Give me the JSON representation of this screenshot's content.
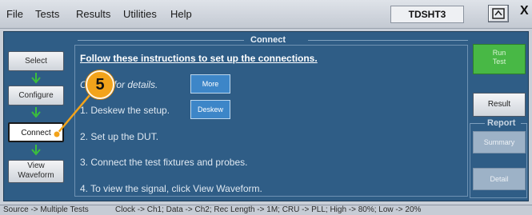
{
  "menu": {
    "items": [
      "File",
      "Tests",
      "Results",
      "Utilities",
      "Help"
    ],
    "instrument": "TDSHT3",
    "close_glyph": "X"
  },
  "panel": {
    "title": "Connect",
    "headline": "Follow these instructions to set up the connections.",
    "step0_prefix": "C",
    "step0_suffix": "for details.",
    "step1": "1. Deskew the setup.",
    "step2": "2. Set up the DUT.",
    "step3": "3. Connect the test fixtures and probes.",
    "step4": "4. To view the signal, click View Waveform.",
    "more_label": "More",
    "deskew_label": "Deskew"
  },
  "workflow": {
    "select": "Select",
    "configure": "Configure",
    "connect": "Connect",
    "view_line1": "View",
    "view_line2": "Waveform"
  },
  "callout": {
    "number": "5"
  },
  "right": {
    "run_line1": "Run",
    "run_line2": "Test",
    "result": "Result",
    "report": "Report",
    "summary": "Summary",
    "detail": "Detail"
  },
  "status": {
    "left": "Source -> Multiple Tests",
    "right": "Clock -> Ch1; Data -> Ch2; Rec Length -> 1M; CRU -> PLL; High -> 80%; Low -> 20%"
  },
  "colors": {
    "panel_bg": "#2f5d86",
    "run_green": "#48b845",
    "callout_orange": "#f2a31b",
    "arrow_green": "#3bbf3b",
    "button_blue": "#3d86c8"
  },
  "icons": {
    "flow_arrow": "arrow-down-icon",
    "window_restore": "window-restore-icon",
    "close": "close-icon"
  }
}
